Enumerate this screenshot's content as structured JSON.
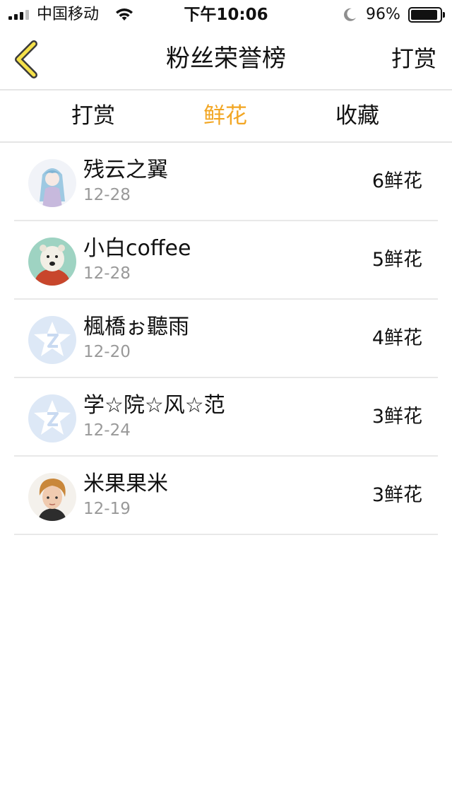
{
  "status_bar": {
    "carrier": "中国移动",
    "time": "下午10:06",
    "battery": "96%",
    "signal_icon": "signal-bars-icon",
    "wifi_icon": "wifi-icon",
    "moon_icon": "do-not-disturb-moon-icon"
  },
  "nav": {
    "back_icon": "chevron-left-icon",
    "title": "粉丝荣誉榜",
    "right_action": "打赏"
  },
  "tabs": [
    {
      "label": "打赏",
      "active": false
    },
    {
      "label": "鲜花",
      "active": true
    },
    {
      "label": "收藏",
      "active": false
    }
  ],
  "colors": {
    "accent": "#f2a623",
    "divider": "#e5e5e5",
    "muted_text": "#999999"
  },
  "fans": [
    {
      "name": "残云之翼",
      "date": "12-28",
      "count": "6鲜花",
      "avatar": "anime-girl-avatar"
    },
    {
      "name": "小白coffee",
      "date": "12-28",
      "count": "5鲜花",
      "avatar": "polar-bear-avatar"
    },
    {
      "name": "楓橋ぉ聽雨",
      "date": "12-20",
      "count": "4鲜花",
      "avatar": "default-qq-avatar"
    },
    {
      "name": "学☆院☆风☆范",
      "date": "12-24",
      "count": "3鲜花",
      "avatar": "default-qq-avatar"
    },
    {
      "name": "米果果米",
      "date": "12-19",
      "count": "3鲜花",
      "avatar": "young-man-avatar"
    }
  ]
}
